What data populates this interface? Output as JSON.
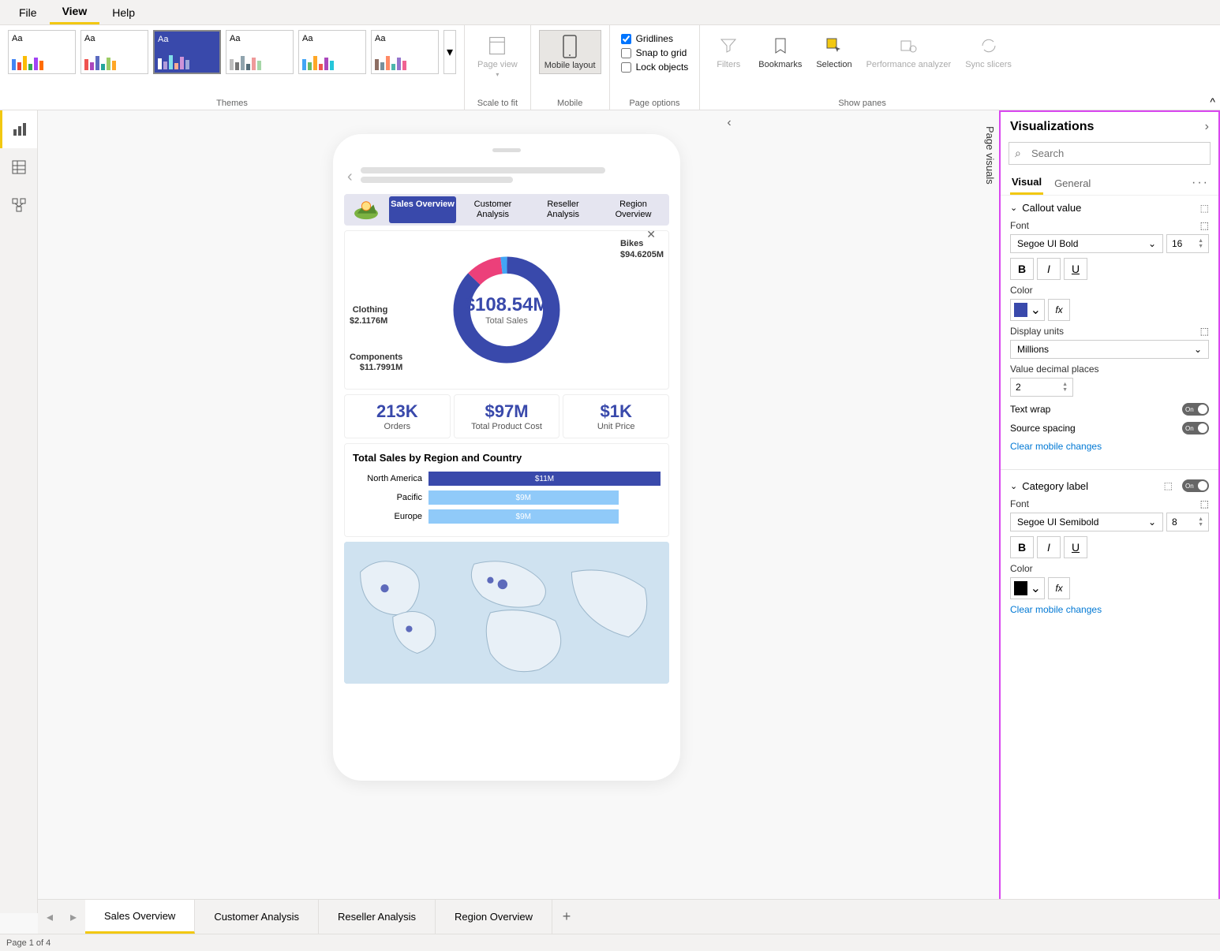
{
  "menubar": {
    "items": [
      "File",
      "View",
      "Help"
    ],
    "active": 1
  },
  "ribbon": {
    "themes_label": "Themes",
    "scale_label": "Scale to fit",
    "mobile_label": "Mobile",
    "page_options_label": "Page options",
    "show_panes_label": "Show panes",
    "page_view": "Page view",
    "mobile_layout": "Mobile layout",
    "gridlines": "Gridlines",
    "snap": "Snap to grid",
    "lock": "Lock objects",
    "filters": "Filters",
    "bookmarks": "Bookmarks",
    "selection": "Selection",
    "perf": "Performance analyzer",
    "sync": "Sync slicers"
  },
  "left_rail": {
    "items": [
      "report-view",
      "data-view",
      "model-view"
    ]
  },
  "page_visuals_label": "Page visuals",
  "phone": {
    "tabs": [
      "Sales Overview",
      "Customer Analysis",
      "Reseller Analysis",
      "Region Overview"
    ],
    "donut": {
      "center_value": "$108.54M",
      "center_label": "Total Sales",
      "labels": [
        {
          "name": "Bikes",
          "value": "$94.6205M"
        },
        {
          "name": "Clothing",
          "value": "$2.1176M"
        },
        {
          "name": "Components",
          "value": "$11.7991M"
        }
      ]
    },
    "kpis": [
      {
        "value": "213K",
        "label": "Orders"
      },
      {
        "value": "$97M",
        "label": "Total Product Cost"
      },
      {
        "value": "$1K",
        "label": "Unit Price"
      }
    ],
    "bar_chart_title": "Total Sales by Region and Country"
  },
  "chart_data": [
    {
      "type": "pie",
      "title": "Total Sales",
      "total": 108.54,
      "unit": "$M",
      "series": [
        {
          "name": "Bikes",
          "value": 94.6205,
          "color": "#3949ab"
        },
        {
          "name": "Components",
          "value": 11.7991,
          "color": "#ec407a"
        },
        {
          "name": "Clothing",
          "value": 2.1176,
          "color": "#42a5f5"
        }
      ]
    },
    {
      "type": "bar",
      "title": "Total Sales by Region and Country",
      "categories": [
        "North America",
        "Pacific",
        "Europe"
      ],
      "values": [
        11,
        9,
        9
      ],
      "unit": "$M",
      "colors": [
        "#3949ab",
        "#90caf9",
        "#90caf9"
      ],
      "xlim": [
        0,
        11
      ]
    }
  ],
  "pane": {
    "title": "Visualizations",
    "search_placeholder": "Search",
    "tabs": [
      "Visual",
      "General"
    ],
    "sections": {
      "callout": {
        "title": "Callout value",
        "font_label": "Font",
        "font_value": "Segoe UI Bold",
        "font_size": "16",
        "color_label": "Color",
        "color_value": "#3949ab",
        "display_units_label": "Display units",
        "display_units_value": "Millions",
        "decimals_label": "Value decimal places",
        "decimals_value": "2",
        "text_wrap_label": "Text wrap",
        "text_wrap_state": "On",
        "source_spacing_label": "Source spacing",
        "source_spacing_state": "On",
        "clear_link": "Clear mobile changes"
      },
      "category": {
        "title": "Category label",
        "state": "On",
        "font_label": "Font",
        "font_value": "Segoe UI Semibold",
        "font_size": "8",
        "color_label": "Color",
        "color_value": "#000000",
        "clear_link": "Clear mobile changes"
      }
    }
  },
  "page_tabs": [
    "Sales Overview",
    "Customer Analysis",
    "Reseller Analysis",
    "Region Overview"
  ],
  "status": "Page 1 of 4"
}
